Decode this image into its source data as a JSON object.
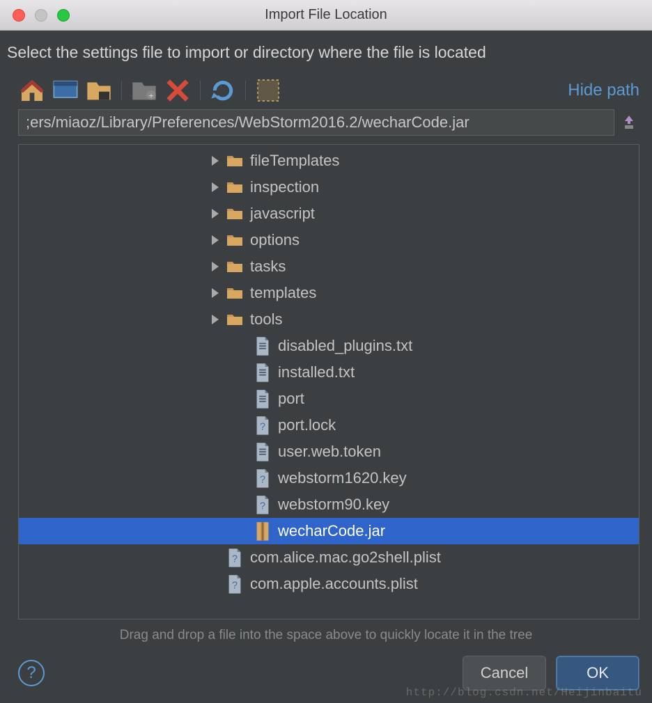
{
  "window": {
    "title": "Import File Location"
  },
  "instruction": "Select the settings file to import or directory where the file is located",
  "toolbar": {
    "items": [
      {
        "name": "home-icon"
      },
      {
        "name": "desktop-icon"
      },
      {
        "name": "project-icon"
      },
      {
        "name": "sep"
      },
      {
        "name": "new-folder-icon"
      },
      {
        "name": "delete-icon"
      },
      {
        "name": "sep"
      },
      {
        "name": "refresh-icon"
      },
      {
        "name": "sep"
      },
      {
        "name": "show-hidden-icon"
      }
    ],
    "hide_path_label": "Hide path"
  },
  "path_input": {
    "value": ";ers/miaoz/Library/Preferences/WebStorm2016.2/wecharCode.jar"
  },
  "tree": [
    {
      "indent": 272,
      "expand": true,
      "type": "folder",
      "label": "fileTemplates",
      "selected": false
    },
    {
      "indent": 272,
      "expand": true,
      "type": "folder",
      "label": "inspection",
      "selected": false
    },
    {
      "indent": 272,
      "expand": true,
      "type": "folder",
      "label": "javascript",
      "selected": false
    },
    {
      "indent": 272,
      "expand": true,
      "type": "folder",
      "label": "options",
      "selected": false
    },
    {
      "indent": 272,
      "expand": true,
      "type": "folder",
      "label": "tasks",
      "selected": false
    },
    {
      "indent": 272,
      "expand": true,
      "type": "folder",
      "label": "templates",
      "selected": false
    },
    {
      "indent": 272,
      "expand": true,
      "type": "folder",
      "label": "tools",
      "selected": false
    },
    {
      "indent": 312,
      "expand": false,
      "type": "file",
      "label": "disabled_plugins.txt",
      "selected": false
    },
    {
      "indent": 312,
      "expand": false,
      "type": "file",
      "label": "installed.txt",
      "selected": false
    },
    {
      "indent": 312,
      "expand": false,
      "type": "file",
      "label": "port",
      "selected": false
    },
    {
      "indent": 312,
      "expand": false,
      "type": "unknown",
      "label": "port.lock",
      "selected": false
    },
    {
      "indent": 312,
      "expand": false,
      "type": "file",
      "label": "user.web.token",
      "selected": false
    },
    {
      "indent": 312,
      "expand": false,
      "type": "unknown",
      "label": "webstorm1620.key",
      "selected": false
    },
    {
      "indent": 312,
      "expand": false,
      "type": "unknown",
      "label": "webstorm90.key",
      "selected": false
    },
    {
      "indent": 312,
      "expand": false,
      "type": "jar",
      "label": "wecharCode.jar",
      "selected": true
    },
    {
      "indent": 272,
      "expand": false,
      "type": "unknown",
      "label": "com.alice.mac.go2shell.plist",
      "selected": false
    },
    {
      "indent": 272,
      "expand": false,
      "type": "unknown",
      "label": "com.apple.accounts.plist",
      "selected": false
    }
  ],
  "hint": "Drag and drop a file into the space above to quickly locate it in the tree",
  "footer": {
    "help": "?",
    "cancel": "Cancel",
    "ok": "OK"
  },
  "watermark": "http://blog.csdn.net/Heijinbaitu"
}
